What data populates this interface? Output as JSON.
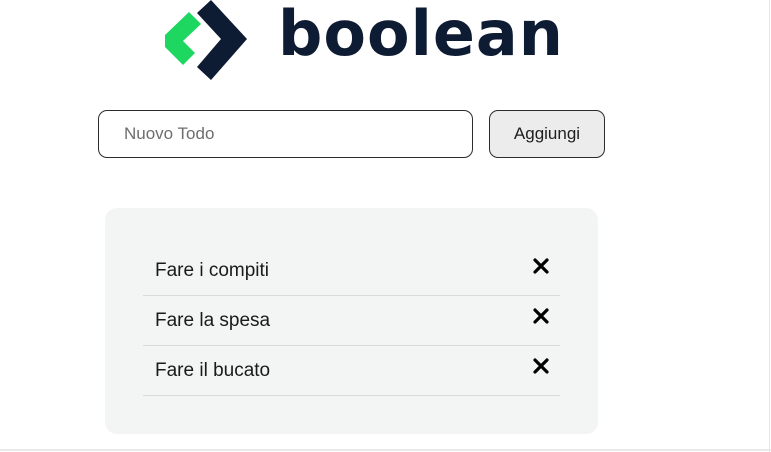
{
  "brand": {
    "name": "boolean",
    "logo_icon": "boolean-chevron-logo-icon",
    "colors": {
      "text": "#0d1b33",
      "accent_green": "#1ed760",
      "dark": "#0d1b33"
    }
  },
  "form": {
    "input_placeholder": "Nuovo Todo",
    "input_value": "",
    "add_label": "Aggiungi"
  },
  "todos": [
    {
      "text": "Fare i compiti",
      "delete_icon": "close-icon"
    },
    {
      "text": "Fare la spesa",
      "delete_icon": "close-icon"
    },
    {
      "text": "Fare il bucato",
      "delete_icon": "close-icon"
    }
  ]
}
